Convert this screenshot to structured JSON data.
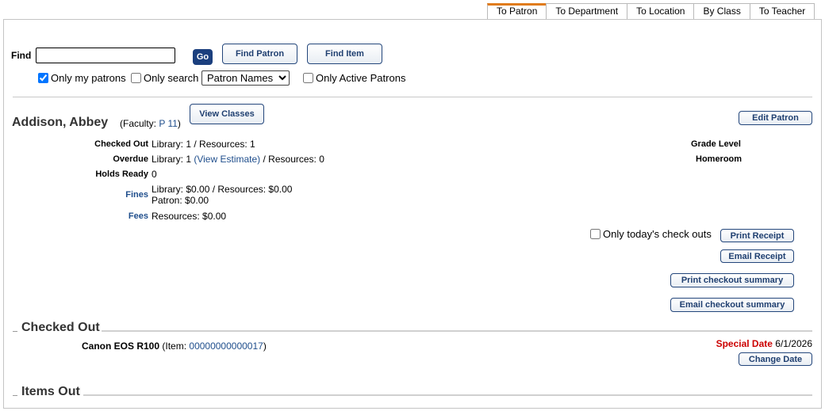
{
  "tabs": [
    {
      "label": "To Patron",
      "active": true
    },
    {
      "label": "To Department",
      "active": false
    },
    {
      "label": "To Location",
      "active": false
    },
    {
      "label": "By Class",
      "active": false
    },
    {
      "label": "To Teacher",
      "active": false
    }
  ],
  "search": {
    "find_label": "Find",
    "find_value": "",
    "go_label": "Go",
    "find_patron_label": "Find Patron",
    "find_item_label": "Find Item",
    "only_my_patrons_label": "Only my patrons",
    "only_my_patrons_checked": true,
    "only_search_label": "Only search",
    "only_search_checked": false,
    "search_scope_selected": "Patron Names",
    "only_active_label": "Only Active Patrons",
    "only_active_checked": false
  },
  "patron": {
    "name": "Addison, Abbey",
    "faculty_prefix": "(Faculty: ",
    "faculty_link": "P 11",
    "faculty_suffix": ")",
    "view_classes_label": "View Classes",
    "edit_patron_label": "Edit Patron",
    "stats": {
      "checked_out_label": "Checked Out",
      "checked_out_value": "Library: 1 / Resources: 1",
      "overdue_label": "Overdue",
      "overdue_prefix": "Library: 1 ",
      "overdue_link": "(View Estimate)",
      "overdue_suffix": " / Resources: 0",
      "holds_label": "Holds Ready",
      "holds_value": "0",
      "fines_label": "Fines",
      "fines_line1": "Library: $0.00 / Resources: $0.00",
      "fines_line2": "Patron: $0.00",
      "fees_label": "Fees",
      "fees_value": "Resources: $0.00"
    },
    "grade_level_label": "Grade Level",
    "homeroom_label": "Homeroom"
  },
  "receipts": {
    "only_today_label": "Only today's check outs",
    "only_today_checked": false,
    "print_receipt_label": "Print Receipt",
    "email_receipt_label": "Email Receipt",
    "print_summary_label": "Print checkout summary",
    "email_summary_label": "Email checkout summary"
  },
  "checked_out": {
    "title": "Checked Out",
    "items": [
      {
        "name": "Canon EOS R100",
        "item_prefix": "(Item: ",
        "item_id": "00000000000017",
        "item_suffix": ")",
        "special_date_label": "Special Date",
        "special_date_value": "6/1/2026",
        "change_date_label": "Change Date"
      }
    ]
  },
  "items_out": {
    "title": "Items Out"
  },
  "colors": {
    "link": "#1f4e8c",
    "special_date": "#cc0000",
    "go_button": "#1b3f7e",
    "active_tab_accent": "#e07b1a"
  }
}
